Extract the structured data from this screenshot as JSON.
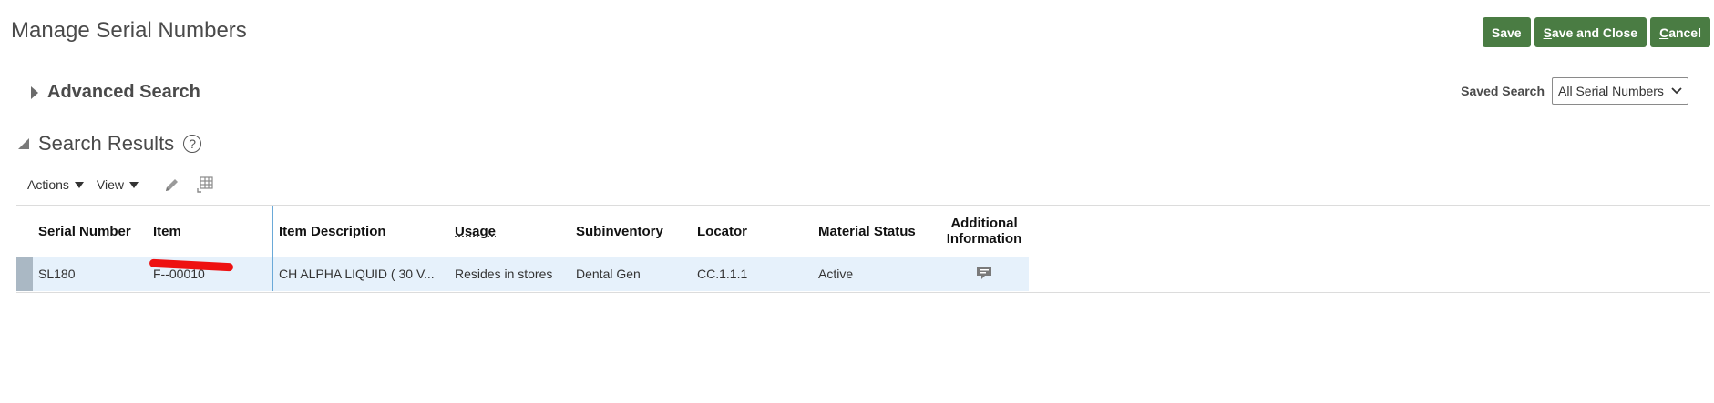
{
  "page": {
    "title": "Manage Serial Numbers"
  },
  "buttons": {
    "save": "Save",
    "save_and_close_rest": "ave and Close",
    "save_and_close_mnemonic": "S",
    "cancel_mnemonic": "C",
    "cancel_rest": "ancel",
    "accent_color": "#4a7c43"
  },
  "advanced_search": {
    "label": "Advanced Search",
    "expanded": false
  },
  "saved_search": {
    "label": "Saved Search",
    "value": "All Serial Numbers"
  },
  "search_results": {
    "label": "Search Results",
    "help": "?"
  },
  "toolbar": {
    "actions": "Actions",
    "view": "View",
    "icons": [
      "pencil-edit-icon",
      "freeze-columns-icon"
    ]
  },
  "table": {
    "columns": [
      "Serial Number",
      "Item",
      "Item Description",
      "Usage",
      "Subinventory",
      "Locator",
      "Material Status",
      "Additional Information"
    ],
    "rows": [
      {
        "serial_number": "SL180",
        "item": "F--00010",
        "item_description": "CH ALPHA LIQUID ( 30 V...",
        "usage": "Resides in stores",
        "subinventory": "Dental Gen",
        "locator": "CC.1.1.1",
        "material_status": "Active",
        "additional_information_icon": "details-icon"
      }
    ],
    "selected_row_color": "#e6f1fb"
  }
}
